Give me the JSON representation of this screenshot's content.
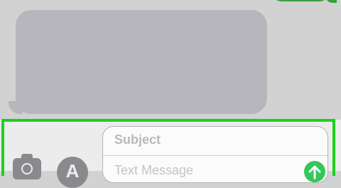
{
  "compose": {
    "subject_placeholder": "Subject",
    "message_placeholder": "Text Message"
  },
  "icons": {
    "camera": "camera-icon",
    "app_store": "app-store-icon",
    "send": "send-arrow-icon"
  },
  "colors": {
    "sent_bubble": "#3aa23a",
    "received_bubble": "#b7b6bd",
    "highlight": "#1cd11c",
    "send_button": "#34c759"
  }
}
